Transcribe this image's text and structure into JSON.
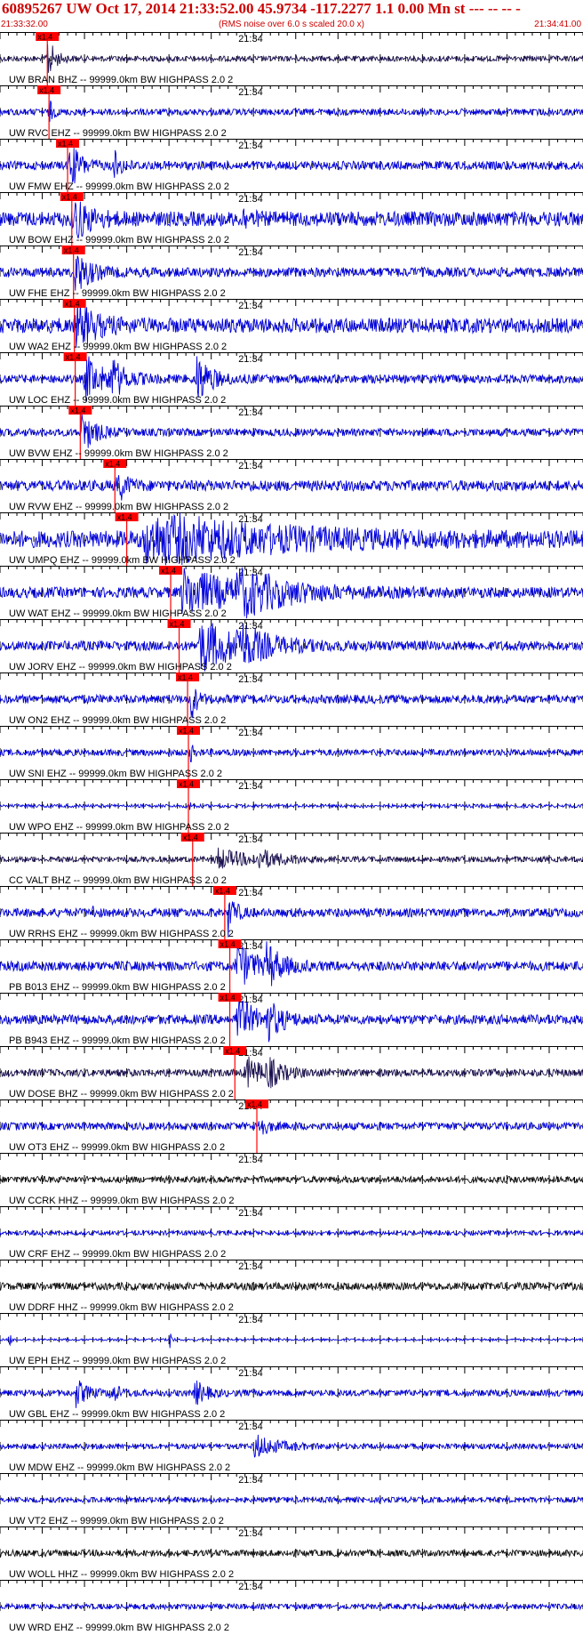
{
  "header": {
    "event_title": "60895267 UW Oct 17, 2014 21:33:52.00   45.9734 -117.2277  1.1 0.00 Mn st --- -- --   -",
    "start_time": "21:33:32.00",
    "scale_note": "(RMS noise over 6.0 s scaled 20.0 x)",
    "end_time": "21:34:41.00"
  },
  "colors": {
    "trace_default": "#0000dd",
    "trace_broadband": "#1a1050",
    "trace_black": "#111111",
    "pick_flag": "#ff0000",
    "axis": "#000000"
  },
  "chart_data": {
    "type": "line",
    "x_range": [
      "21:33:32.00",
      "21:34:41.00"
    ],
    "minute_label": "21:34",
    "pick_label": "x1.4",
    "series": [
      {
        "name": "UW BRAN BHZ -- 99999.0km BW  HIGHPASS  2.0  2",
        "color": "#1a1050",
        "amp": 0.1,
        "pick": 5.6,
        "bursts": [
          [
            5.6,
            0.9,
            0.8
          ]
        ]
      },
      {
        "name": "UW RVC EHZ -- 99999.0km BW  HIGHPASS  2.0  2",
        "color": "#0000dd",
        "amp": 0.12,
        "pick": 5.8,
        "bursts": [
          [
            5.8,
            0.5,
            0.4
          ]
        ]
      },
      {
        "name": "UW FMW EHZ -- 99999.0km BW  HIGHPASS  2.0  2",
        "color": "#0000dd",
        "amp": 0.16,
        "pick": 8.0,
        "bursts": [
          [
            8.2,
            0.9,
            1.2
          ],
          [
            13.5,
            0.5,
            0.8
          ]
        ]
      },
      {
        "name": "UW BOW EHZ -- 99999.0km BW  HIGHPASS  2.0  2",
        "color": "#0000dd",
        "amp": 0.28,
        "pick": 8.5,
        "bursts": [
          [
            8.7,
            0.8,
            1.6
          ],
          [
            28.5,
            0.4,
            0.8
          ]
        ]
      },
      {
        "name": "UW FHE EHZ -- 99999.0km BW  HIGHPASS  2.0  2",
        "color": "#0000dd",
        "amp": 0.18,
        "pick": 8.7,
        "bursts": [
          [
            8.9,
            0.85,
            1.5
          ]
        ]
      },
      {
        "name": "UW WA2 EHZ -- 99999.0km BW  HIGHPASS  2.0  2",
        "color": "#0000dd",
        "amp": 0.28,
        "pick": 8.8,
        "bursts": [
          [
            9.0,
            0.9,
            2.0
          ]
        ]
      },
      {
        "name": "UW LOC EHZ -- 99999.0km BW  HIGHPASS  2.0  2",
        "color": "#0000dd",
        "amp": 0.16,
        "pick": 8.9,
        "bursts": [
          [
            10.0,
            0.9,
            2.0
          ],
          [
            13.0,
            0.7,
            1.5
          ],
          [
            23.2,
            1.0,
            1.5
          ]
        ]
      },
      {
        "name": "UW BVW EHZ -- 99999.0km BW  HIGHPASS  2.0  2",
        "color": "#0000dd",
        "amp": 0.14,
        "pick": 9.5,
        "bursts": [
          [
            9.6,
            0.8,
            1.5
          ]
        ]
      },
      {
        "name": "UW RVW EHZ -- 99999.0km BW  HIGHPASS  2.0  2",
        "color": "#0000dd",
        "amp": 0.2,
        "pick": 13.6,
        "bursts": [
          [
            13.9,
            0.6,
            1.0
          ]
        ]
      },
      {
        "name": "UW UMPQ EHZ -- 99999.0km BW  HIGHPASS  2.0  2",
        "color": "#0000dd",
        "amp": 0.32,
        "pick": 15.0,
        "bursts": [
          [
            17.0,
            1.0,
            12.0
          ]
        ]
      },
      {
        "name": "UW WAT EHZ -- 99999.0km BW  HIGHPASS  2.0  2",
        "color": "#0000dd",
        "amp": 0.2,
        "pick": 20.2,
        "bursts": [
          [
            21.5,
            0.9,
            6.0
          ],
          [
            28.0,
            0.75,
            5.0
          ]
        ]
      },
      {
        "name": "UW JORV EHZ -- 99999.0km BW  HIGHPASS  2.0  2",
        "color": "#0000dd",
        "amp": 0.18,
        "pick": 21.2,
        "bursts": [
          [
            23.5,
            1.0,
            4.5
          ],
          [
            28.0,
            0.7,
            2.5
          ]
        ]
      },
      {
        "name": "UW ON2 EHZ -- 99999.0km BW  HIGHPASS  2.0  2",
        "color": "#0000dd",
        "amp": 0.16,
        "pick": 22.2,
        "bursts": [
          [
            22.5,
            1.0,
            0.6
          ]
        ]
      },
      {
        "name": "UW SNI EHZ -- 99999.0km BW  HIGHPASS  2.0  2",
        "color": "#0000dd",
        "amp": 0.12,
        "pick": 22.3,
        "bursts": [
          [
            22.5,
            0.35,
            0.4
          ]
        ]
      },
      {
        "name": "UW WPO EHZ -- 99999.0km BW  HIGHPASS  2.0  2",
        "color": "#0000dd",
        "amp": 0.06,
        "pick": 22.3,
        "bursts": [
          [
            22.4,
            0.2,
            0.3
          ]
        ]
      },
      {
        "name": "CC VALT BHZ -- 99999.0km BW  HIGHPASS  2.0  2",
        "color": "#1a1050",
        "amp": 0.1,
        "pick": 22.8,
        "bursts": [
          [
            25.5,
            0.4,
            3.5
          ],
          [
            30.5,
            0.3,
            2.5
          ]
        ]
      },
      {
        "name": "UW RRHS EHZ -- 99999.0km BW  HIGHPASS  2.0  2",
        "color": "#0000dd",
        "amp": 0.16,
        "pick": 26.6,
        "bursts": [
          [
            27.0,
            0.8,
            0.8
          ],
          [
            10.8,
            0.4,
            0.3
          ]
        ]
      },
      {
        "name": "PB B013 EHZ -- 99999.0km BW  HIGHPASS  2.0  2",
        "color": "#0000dd",
        "amp": 0.18,
        "pick": 27.2,
        "bursts": [
          [
            28.0,
            0.9,
            2.0
          ],
          [
            31.5,
            0.8,
            1.5
          ]
        ]
      },
      {
        "name": "PB B943 EHZ -- 99999.0km BW  HIGHPASS  2.0  2",
        "color": "#0000dd",
        "amp": 0.18,
        "pick": 27.2,
        "bursts": [
          [
            28.0,
            0.85,
            2.0
          ],
          [
            31.5,
            0.7,
            1.5
          ]
        ]
      },
      {
        "name": "UW DOSE BHZ -- 99999.0km BW  HIGHPASS  2.0  2",
        "color": "#1a1050",
        "amp": 0.14,
        "pick": 27.8,
        "bursts": [
          [
            29.0,
            0.6,
            2.0
          ],
          [
            31.5,
            0.5,
            1.5
          ]
        ]
      },
      {
        "name": "UW OT3 EHZ -- 99999.0km BW  HIGHPASS  2.0  2",
        "color": "#0000dd",
        "amp": 0.14,
        "pick": 30.4,
        "bursts": [
          [
            30.6,
            0.5,
            0.8
          ]
        ]
      },
      {
        "name": "UW CCRK HHZ -- 99999.0km BW  HIGHPASS  2.0  2",
        "color": "#111111",
        "amp": 0.12,
        "bursts": []
      },
      {
        "name": "UW CRF EHZ -- 99999.0km BW  HIGHPASS  2.0  2",
        "color": "#0000dd",
        "amp": 0.08,
        "bursts": []
      },
      {
        "name": "UW DDRF HHZ -- 99999.0km BW  HIGHPASS  2.0  2",
        "color": "#111111",
        "amp": 0.14,
        "bursts": []
      },
      {
        "name": "UW EPH EHZ -- 99999.0km BW  HIGHPASS  2.0  2",
        "color": "#0000dd",
        "amp": 0.04,
        "bursts": [
          [
            1.1,
            0.6,
            0.15
          ],
          [
            20.1,
            0.6,
            0.15
          ]
        ]
      },
      {
        "name": "UW GBL EHZ -- 99999.0km BW  HIGHPASS  2.0  2",
        "color": "#0000dd",
        "amp": 0.12,
        "bursts": [
          [
            9.0,
            0.5,
            1.2
          ],
          [
            13.0,
            0.4,
            1.0
          ],
          [
            23.0,
            0.5,
            1.2
          ]
        ]
      },
      {
        "name": "UW MDW EHZ -- 99999.0km BW  HIGHPASS  2.0  2",
        "color": "#0000dd",
        "amp": 0.1,
        "bursts": [
          [
            30.0,
            0.45,
            2.5
          ]
        ]
      },
      {
        "name": "UW VT2 EHZ -- 99999.0km BW  HIGHPASS  2.0  2",
        "color": "#0000dd",
        "amp": 0.1,
        "bursts": []
      },
      {
        "name": "UW WOLL HHZ -- 99999.0km BW  HIGHPASS  2.0  2",
        "color": "#111111",
        "amp": 0.12,
        "bursts": []
      },
      {
        "name": "UW WRD EHZ -- 99999.0km BW  HIGHPASS  2.0  2",
        "color": "#0000dd",
        "amp": 0.1,
        "bursts": []
      }
    ]
  }
}
